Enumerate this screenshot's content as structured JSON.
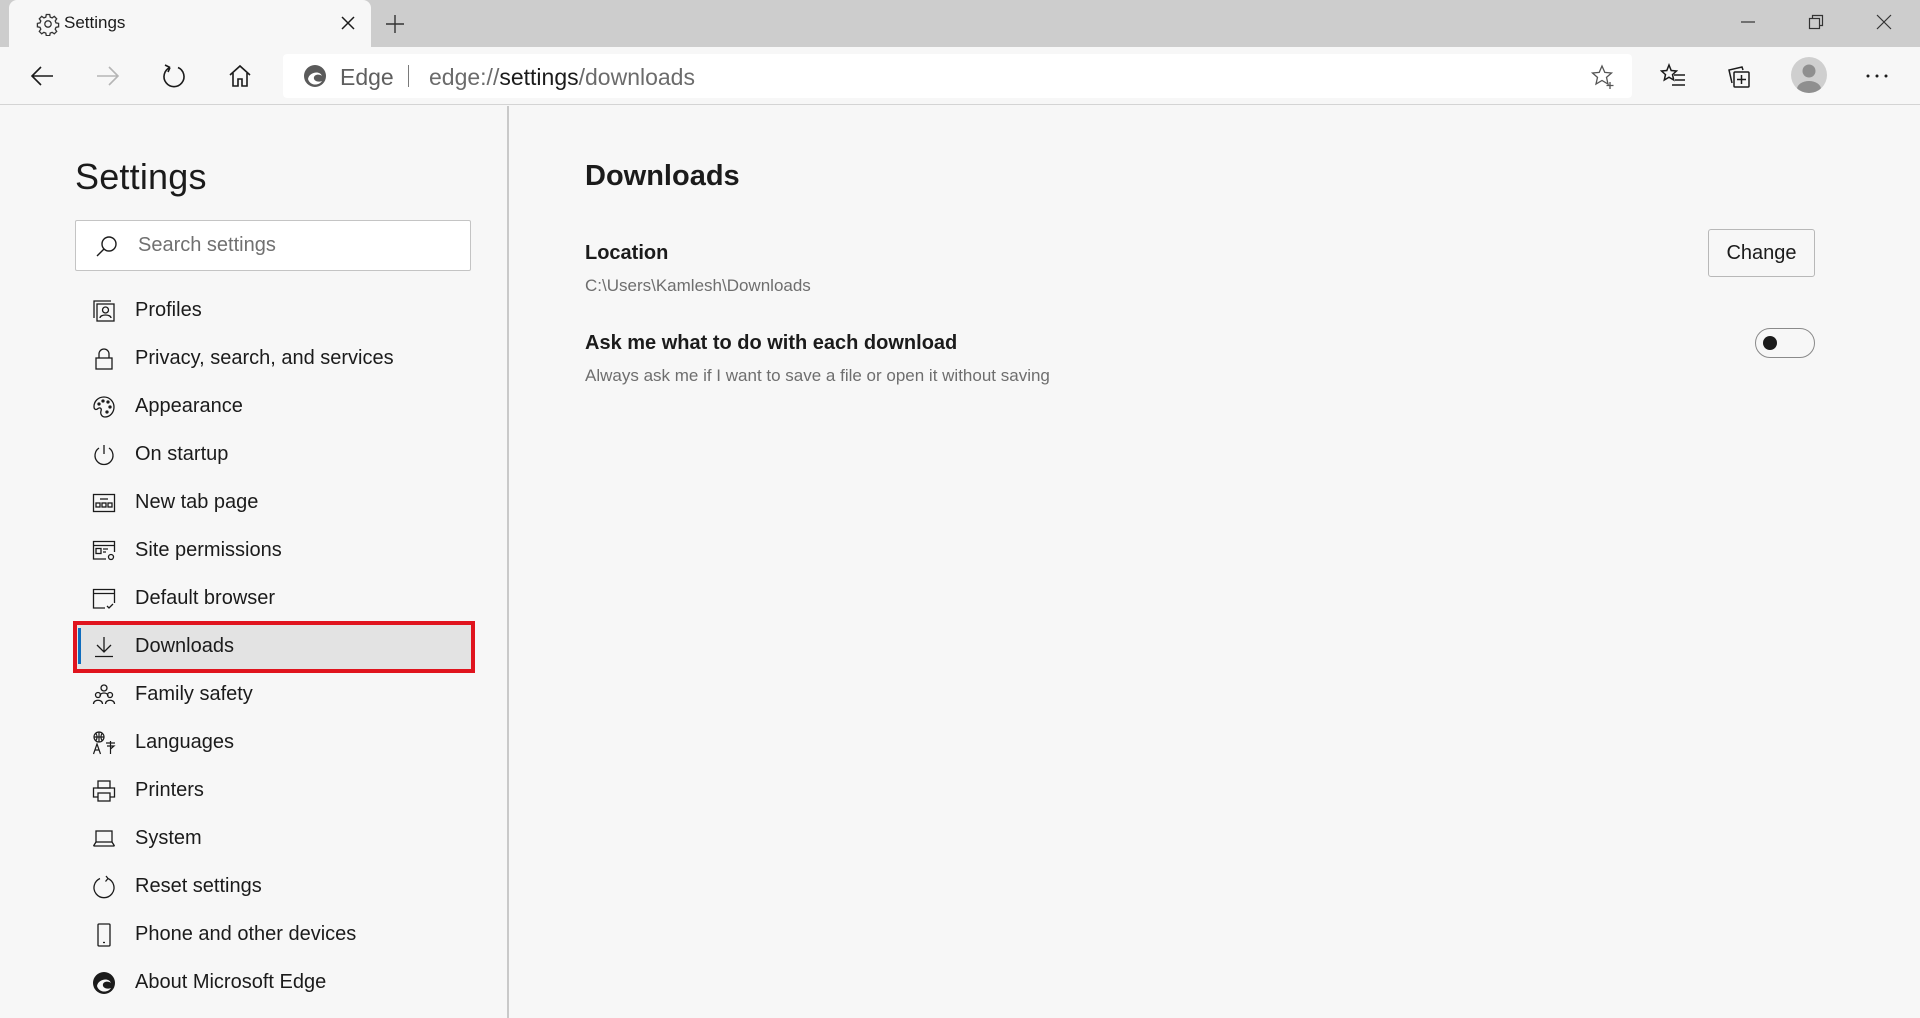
{
  "browser": {
    "tab": {
      "title": "Settings",
      "icon": "gear-icon"
    },
    "new_tab_icon": "plus-icon",
    "window_controls": [
      "minimize-icon",
      "restore-icon",
      "close-icon"
    ],
    "toolbar": {
      "back_icon": "arrow-left-icon",
      "forward_icon": "arrow-right-icon",
      "refresh_icon": "refresh-icon",
      "home_icon": "home-icon",
      "favorites_icon": "favorites-list-icon",
      "collections_icon": "collections-icon",
      "more_icon": "more-horizontal-icon"
    },
    "address_bar": {
      "site_label": "Edge",
      "url_prefix": "edge://",
      "url_host": "settings",
      "url_path": "/downloads",
      "add_favorite_icon": "star-plus-icon"
    }
  },
  "sidebar": {
    "title": "Settings",
    "search": {
      "placeholder": "Search settings",
      "value": ""
    },
    "items": [
      {
        "label": "Profiles",
        "icon": "profiles-icon"
      },
      {
        "label": "Privacy, search, and services",
        "icon": "lock-icon"
      },
      {
        "label": "Appearance",
        "icon": "palette-icon"
      },
      {
        "label": "On startup",
        "icon": "power-icon"
      },
      {
        "label": "New tab page",
        "icon": "new-tab-page-icon"
      },
      {
        "label": "Site permissions",
        "icon": "site-permissions-icon"
      },
      {
        "label": "Default browser",
        "icon": "default-browser-icon"
      },
      {
        "label": "Downloads",
        "icon": "download-icon",
        "active": true
      },
      {
        "label": "Family safety",
        "icon": "family-icon"
      },
      {
        "label": "Languages",
        "icon": "languages-icon"
      },
      {
        "label": "Printers",
        "icon": "printer-icon"
      },
      {
        "label": "System",
        "icon": "laptop-icon"
      },
      {
        "label": "Reset settings",
        "icon": "reset-icon"
      },
      {
        "label": "Phone and other devices",
        "icon": "phone-icon"
      },
      {
        "label": "About Microsoft Edge",
        "icon": "edge-logo-icon"
      }
    ]
  },
  "main": {
    "title": "Downloads",
    "location": {
      "label": "Location",
      "path": "C:\\Users\\Kamlesh\\Downloads",
      "button_label": "Change"
    },
    "ask_each_download": {
      "label": "Ask me what to do with each download",
      "description": "Always ask me if I want to save a file or open it without saving",
      "enabled": false
    }
  },
  "colors": {
    "accent": "#0f6cbd",
    "highlight_box": "#e0141e",
    "background": "#f7f7f7",
    "tabstrip": "#cdcdcd"
  }
}
